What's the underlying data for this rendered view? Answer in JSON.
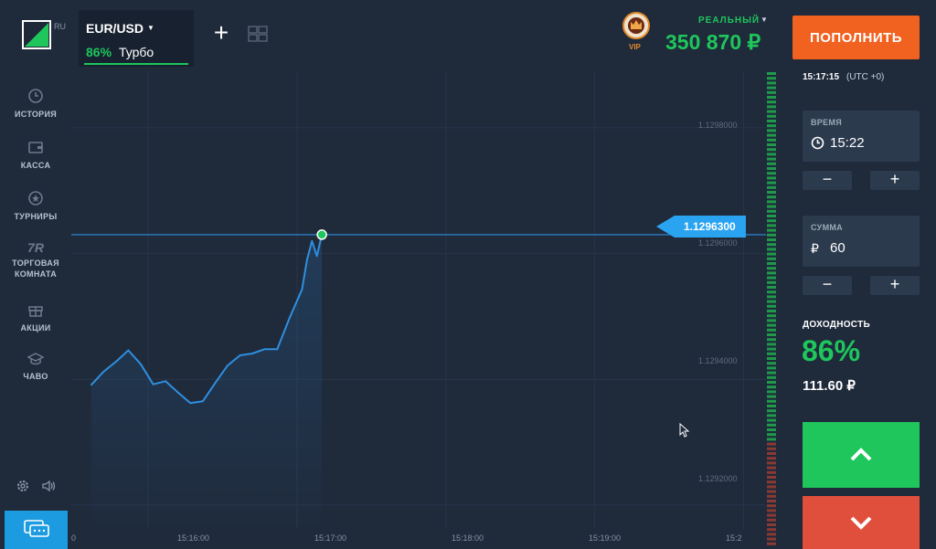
{
  "header": {
    "logo_locale": "RU",
    "asset": {
      "name": "EUR/USD",
      "payout": "86%",
      "mode": "Турбо"
    },
    "add_asset": "+",
    "vip_label": "VIP",
    "account_type": "РЕАЛЬНЫЙ",
    "balance": "350 870 ₽",
    "deposit_label": "ПОПОЛНИТЬ"
  },
  "sidebar": {
    "items": [
      {
        "label": "ИСТОРИЯ",
        "icon": "history-icon"
      },
      {
        "label": "КАССА",
        "icon": "wallet-icon"
      },
      {
        "label": "ТУРНИРЫ",
        "icon": "tournament-icon"
      },
      {
        "label": "ТОРГОВАЯ КОМНАТА",
        "icon": "trading-room-icon"
      },
      {
        "label": "АКЦИИ",
        "icon": "gift-icon"
      },
      {
        "label": "ЧАВО",
        "icon": "graduation-cap-icon"
      }
    ],
    "trading_room_glyph": "7R"
  },
  "chart": {
    "current_price": "1.1296300",
    "y_ticks": [
      "1.1298000",
      "1.1296000",
      "1.1294000",
      "1.1292000"
    ],
    "x_ticks": [
      "15:16:00",
      "15:17:00",
      "15:18:00",
      "15:19:00"
    ],
    "x_ticks_partial": [
      "0",
      "15:2"
    ],
    "colors": {
      "line": "#2e8fe0",
      "price_tag": "#2aa3f0",
      "marker": "#1ec65c"
    }
  },
  "chart_data": {
    "type": "line",
    "x": [
      "15:15:37",
      "15:15:42",
      "15:15:47",
      "15:15:52",
      "15:15:57",
      "15:16:02",
      "15:16:07",
      "15:16:12",
      "15:16:17",
      "15:16:22",
      "15:16:27",
      "15:16:32",
      "15:16:37",
      "15:16:42",
      "15:16:47",
      "15:16:52",
      "15:16:57",
      "15:17:02",
      "15:17:04",
      "15:17:06",
      "15:17:08",
      "15:17:10"
    ],
    "series": [
      {
        "values": [
          1.129391,
          1.129412,
          1.129428,
          1.129446,
          1.129424,
          1.129392,
          1.129397,
          1.129379,
          1.129362,
          1.129365,
          1.129394,
          1.129422,
          1.129438,
          1.129441,
          1.129448,
          1.129448,
          1.129498,
          1.129543,
          1.12959,
          1.12962,
          1.129596,
          1.12963
        ]
      }
    ],
    "ylim": [
      1.12913,
      1.12989
    ],
    "xlim": [
      "15:15:29",
      "15:20:09"
    ],
    "grid": true
  },
  "right_panel": {
    "server_time": "15:17:15",
    "timezone": "(UTC +0)",
    "time_label": "ВРЕМЯ",
    "time_value": "15:22",
    "amount_label": "СУММА",
    "amount_currency": "₽",
    "amount_value": "60",
    "minus": "−",
    "plus": "+",
    "profit_label": "ДОХОДНОСТЬ",
    "profit_pct": "86%",
    "profit_amount": "111.60 ₽"
  }
}
